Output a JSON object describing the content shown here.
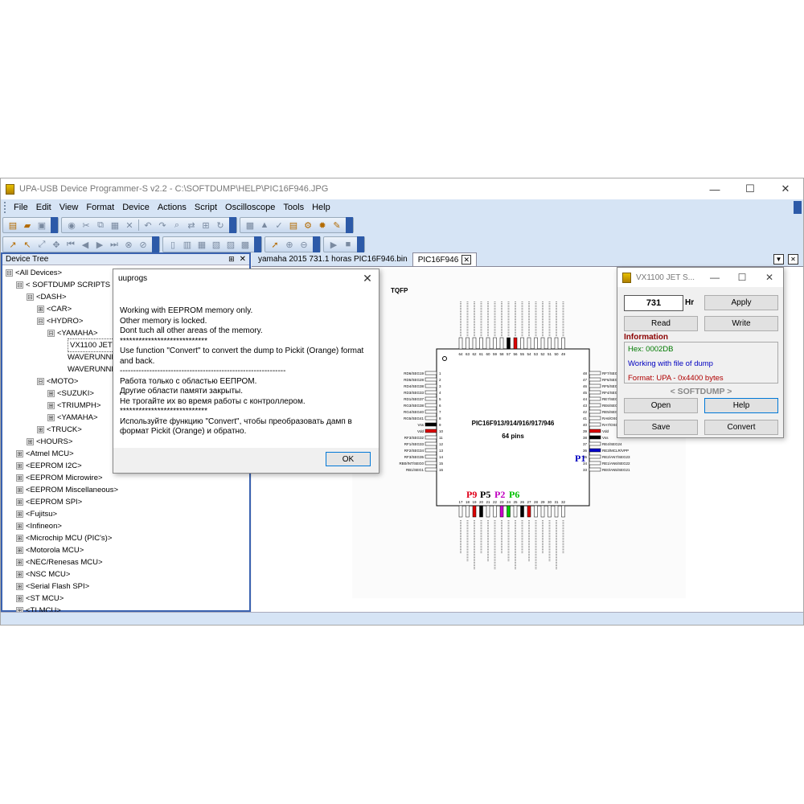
{
  "window": {
    "title": "UPA-USB Device Programmer-S v2.2 - C:\\SOFTDUMP\\HELP\\PIC16F946.JPG",
    "controls": [
      "—",
      "☐",
      "✕"
    ]
  },
  "menu": [
    "File",
    "Edit",
    "View",
    "Format",
    "Device",
    "Actions",
    "Script",
    "Oscilloscope",
    "Tools",
    "Help"
  ],
  "device_tree": {
    "title": "Device Tree",
    "pin": "⊞",
    "close": "✕",
    "nodes": [
      {
        "label": "<All Devices>",
        "level": 0,
        "exp": "⊟"
      },
      {
        "label": "< SOFTDUMP SCRIPTS >",
        "level": 1,
        "exp": "⊟"
      },
      {
        "label": "<DASH>",
        "level": 2,
        "exp": "⊟"
      },
      {
        "label": "<CAR>",
        "level": 3,
        "exp": "⊞"
      },
      {
        "label": "<HYDRO>",
        "level": 3,
        "exp": "⊟"
      },
      {
        "label": "<YAMAHA>",
        "level": 4,
        "exp": "⊟"
      },
      {
        "label": "VX1100 JET SKI",
        "level": 5,
        "exp": "",
        "selected": true
      },
      {
        "label": "WAVERUNNER",
        "level": 5,
        "exp": ""
      },
      {
        "label": "WAVERUNNER",
        "level": 5,
        "exp": ""
      },
      {
        "label": "<MOTO>",
        "level": 3,
        "exp": "⊟"
      },
      {
        "label": "<SUZUKI>",
        "level": 4,
        "exp": "⊞"
      },
      {
        "label": "<TRIUMPH>",
        "level": 4,
        "exp": "⊞"
      },
      {
        "label": "<YAMAHA>",
        "level": 4,
        "exp": "⊞"
      },
      {
        "label": "<TRUCK>",
        "level": 3,
        "exp": "⊞"
      },
      {
        "label": "<HOURS>",
        "level": 2,
        "exp": "⊞"
      },
      {
        "label": "<Atmel MCU>",
        "level": 1,
        "exp": "⊞"
      },
      {
        "label": "<EEPROM I2C>",
        "level": 1,
        "exp": "⊞"
      },
      {
        "label": "<EEPROM Microwire>",
        "level": 1,
        "exp": "⊞"
      },
      {
        "label": "<EEPROM Miscellaneous>",
        "level": 1,
        "exp": "⊞"
      },
      {
        "label": "<EEPROM SPI>",
        "level": 1,
        "exp": "⊞"
      },
      {
        "label": "<Fujitsu>",
        "level": 1,
        "exp": "⊞"
      },
      {
        "label": "<Infineon>",
        "level": 1,
        "exp": "⊞"
      },
      {
        "label": "<Microchip MCU (PIC's)>",
        "level": 1,
        "exp": "⊞"
      },
      {
        "label": "<Motorola MCU>",
        "level": 1,
        "exp": "⊞"
      },
      {
        "label": "<NEC/Renesas MCU>",
        "level": 1,
        "exp": "⊞"
      },
      {
        "label": "<NSC MCU>",
        "level": 1,
        "exp": "⊞"
      },
      {
        "label": "<Serial Flash SPI>",
        "level": 1,
        "exp": "⊞"
      },
      {
        "label": "<ST MCU>",
        "level": 1,
        "exp": "⊞"
      },
      {
        "label": "<TI MCU>",
        "level": 1,
        "exp": "⊞"
      }
    ]
  },
  "tabs": [
    {
      "label": "yamaha 2015 731.1 horas PIC16F946.bin",
      "active": false
    },
    {
      "label": "PIC16F946",
      "active": true,
      "close": "✕"
    }
  ],
  "chip": {
    "package": "TQFP",
    "part": "PIC16F913/914/916/917/946",
    "pins": "64 pins",
    "markers": [
      {
        "label": "P9",
        "color": "#e0001a"
      },
      {
        "label": "P5",
        "color": "#000000"
      },
      {
        "label": "P2",
        "color": "#c000c0"
      },
      {
        "label": "P6",
        "color": "#00c000"
      },
      {
        "label": "P1",
        "color": "#0000c0"
      }
    ],
    "left_pins": [
      "RD6/SEG19",
      "RD5/SEG28",
      "RD4/SEG38",
      "RD3/SEG33",
      "RD1/SEG37",
      "RG3/SEG38",
      "RG4/SEG40",
      "RG5/SEG41",
      "Vss",
      "Vdd",
      "RF3/SEG32",
      "RF1/SEG33",
      "RF2/SEG34",
      "RF3/SEG35",
      "RB0/INT/SEG0",
      "RB1/SEG1"
    ],
    "right_pins": [
      "RF7/SEG31",
      "RF6/SEG30",
      "RF5/SEG29",
      "RF4/SEG28",
      "RE7/SEG27",
      "RE6/SEG26",
      "RE5/SEG25",
      "RA6/OSC2/CLKOUT/T1OSO",
      "RA7/OSC1/CLKIN/T1OSI",
      "Vdd",
      "Vss",
      "RE4/SEG24",
      "RE3/MCLR/VPP",
      "RE2/AN7/SEG23",
      "RE1/AN6/SEG22",
      "RE0/AN5/SEG21"
    ],
    "top_nums": [
      "64",
      "63",
      "62",
      "61",
      "60",
      "59",
      "58",
      "57",
      "56",
      "55",
      "54",
      "53",
      "52",
      "51",
      "50",
      "49"
    ],
    "bottom_nums": [
      "17",
      "18",
      "19",
      "20",
      "21",
      "22",
      "23",
      "24",
      "25",
      "26",
      "27",
      "28",
      "29",
      "30",
      "31",
      "32"
    ],
    "left_nums": [
      "1",
      "2",
      "3",
      "4",
      "5",
      "6",
      "7",
      "8",
      "9",
      "10",
      "11",
      "12",
      "13",
      "14",
      "15",
      "16"
    ],
    "right_nums": [
      "48",
      "47",
      "46",
      "45",
      "44",
      "43",
      "42",
      "41",
      "40",
      "39",
      "38",
      "37",
      "36",
      "35",
      "34",
      "33"
    ]
  },
  "dialog": {
    "title": "uuprogs",
    "close": "✕",
    "lines": [
      "Working with EEPROM memory only.",
      "Other memory is locked.",
      "Dont tuch all other areas of the memory.",
      "****************************",
      "Use function \"Convert\" to convert the dump to Pickit (Orange) format",
      "and back.",
      "--------------------------------------------------------------",
      "Работа только с областью EEПРОМ.",
      "Другие области памяти закрыты.",
      "Не трогайте их во время работы с контроллером.",
      "****************************",
      "Используйте функцию \"Convert\", чтобы преобразовать дамп в",
      "формат Pickit (Orange) и обратно."
    ],
    "ok": "OK"
  },
  "tool": {
    "title": "VX1100 JET S...",
    "controls": [
      "—",
      "☐",
      "✕"
    ],
    "hours_value": "731",
    "hours_unit": "Hr",
    "apply": "Apply",
    "read": "Read",
    "write": "Write",
    "info_label": "Information",
    "hex": "Hex: 0002DB",
    "hex_color": "#007a00",
    "working": "Working with file of dump",
    "working_color": "#0000c0",
    "format": "Format: UPA - 0x4400 bytes",
    "format_color": "#b00000",
    "brand": "< SOFTDUMP >",
    "open": "Open",
    "help": "Help",
    "save": "Save",
    "convert": "Convert"
  }
}
